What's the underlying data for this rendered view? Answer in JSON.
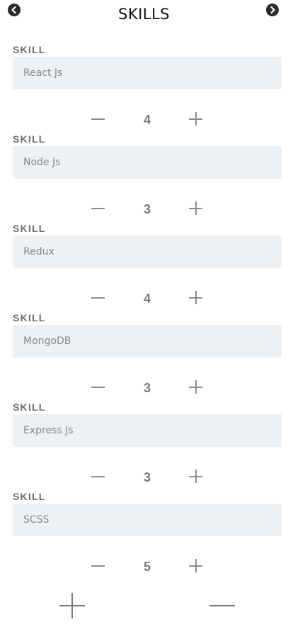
{
  "header": {
    "title": "SKILLS",
    "back_icon": "chevron-left-circle",
    "forward_icon": "chevron-right-circle"
  },
  "skills": [
    {
      "label": "SKILL",
      "value": "React Js",
      "level": "4"
    },
    {
      "label": "SKILL",
      "value": "Node Js",
      "level": "3"
    },
    {
      "label": "SKILL",
      "value": "Redux",
      "level": "4"
    },
    {
      "label": "SKILL",
      "value": "MongoDB",
      "level": "3"
    },
    {
      "label": "SKILL",
      "value": "Express Js",
      "level": "3"
    },
    {
      "label": "SKILL",
      "value": "SCSS",
      "level": "5"
    }
  ],
  "footer": {
    "add_icon": "plus",
    "remove_icon": "minus"
  }
}
